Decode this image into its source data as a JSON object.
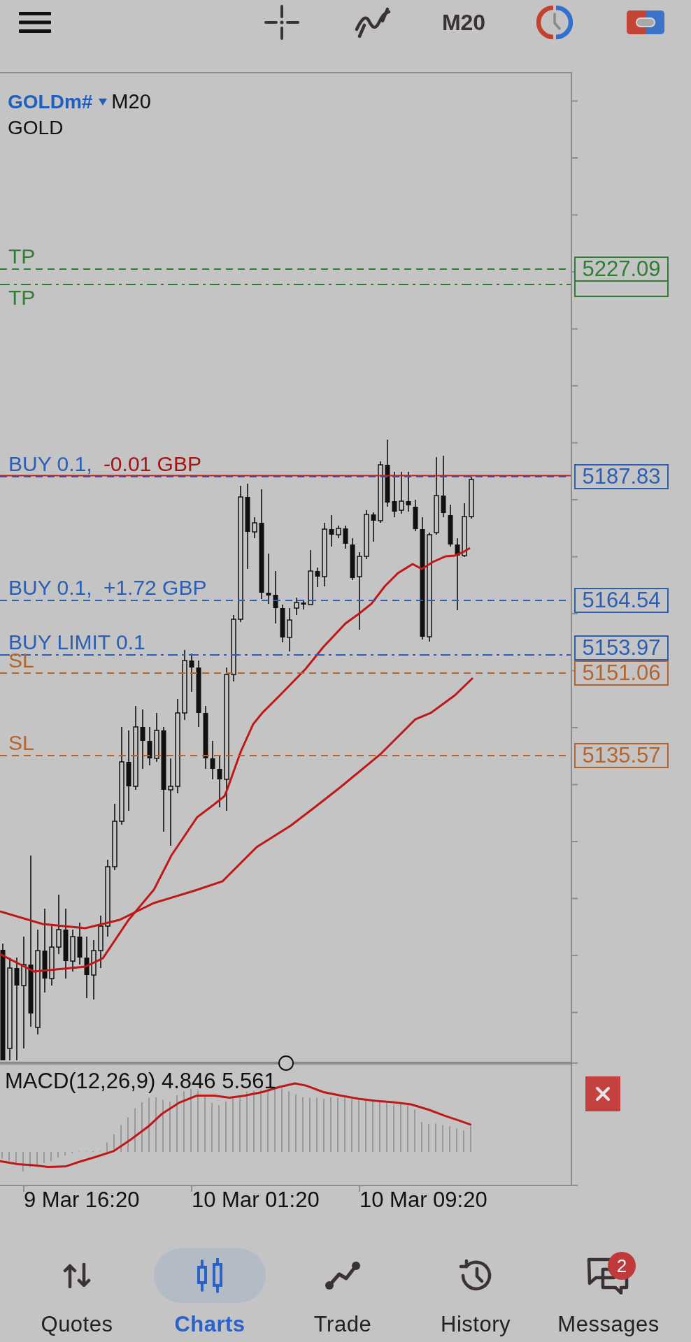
{
  "toolbar": {
    "timeframe": "M20"
  },
  "chart": {
    "symbol": "GOLDm#",
    "timeframe": "M20",
    "description": "GOLD",
    "levels": [
      {
        "kind": "take_profit",
        "label": "TP",
        "price": "5227.09",
        "dash_dot": false
      },
      {
        "kind": "take_profit",
        "label": "TP",
        "dash_dot": true
      },
      {
        "kind": "position",
        "label": "BUY 0.1,",
        "profit": "-0.01 GBP",
        "loss": true,
        "price": "5187.83",
        "dash_dot": false
      },
      {
        "kind": "position",
        "label": "BUY 0.1,",
        "profit": "+1.72 GBP",
        "loss": false,
        "price": "5164.54",
        "dash_dot": false
      },
      {
        "kind": "order",
        "label": "BUY LIMIT 0.1",
        "price": "5153.97",
        "dash_dot": true
      },
      {
        "kind": "stop_loss",
        "label": "SL",
        "price": "5151.06",
        "dash_dot": false
      },
      {
        "kind": "stop_loss",
        "label": "SL",
        "price": "5135.57",
        "dash_dot": false
      }
    ],
    "indicator": {
      "label": "MACD(12,26,9) 4.846 5.561"
    },
    "time_labels": [
      "9 Mar 16:20",
      "10 Mar 01:20",
      "10 Mar 09:20"
    ]
  },
  "nav": [
    {
      "label": "Quotes",
      "selected": false
    },
    {
      "label": "Charts",
      "selected": true
    },
    {
      "label": "Trade",
      "selected": false
    },
    {
      "label": "History",
      "selected": false
    },
    {
      "label": "Messages",
      "selected": false,
      "badge": "2"
    }
  ]
}
